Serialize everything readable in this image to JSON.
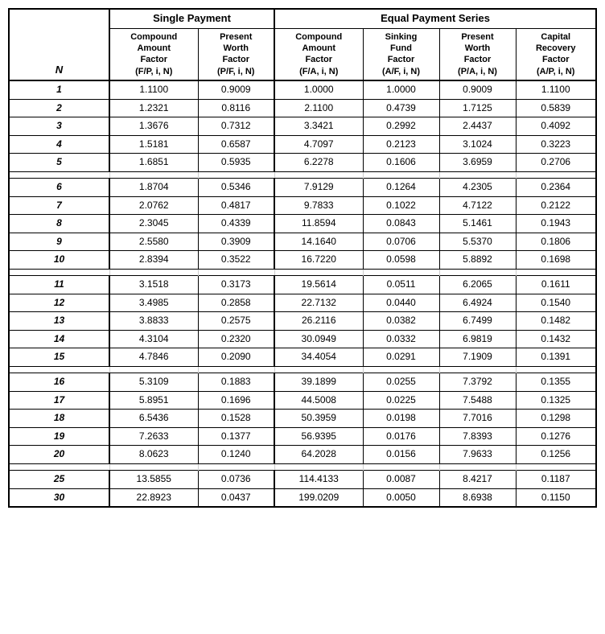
{
  "header": {
    "single_payment": "Single Payment",
    "equal_payment": "Equal Payment Series"
  },
  "col_headers": {
    "n": "N",
    "compound_amount_factor": "Compound\nAmount\nFactor\n(F/P, i, N)",
    "present_worth_factor": "Present\nWorth\nFactor\n(P/F, i, N)",
    "eq_compound_amount": "Compound\nAmount\nFactor\n(F/A, i, N)",
    "sinking_fund": "Sinking\nFund\nFactor\n(A/F, i, N)",
    "present_worth": "Present\nWorth\nFactor\n(P/A, i, N)",
    "capital_recovery": "Capital\nRecovery\nFactor\n(A/P, i, N)"
  },
  "rows": [
    {
      "n": "1",
      "f_p": "1.1100",
      "p_f": "0.9009",
      "f_a": "1.0000",
      "a_f": "1.0000",
      "p_a": "0.9009",
      "a_p": "1.1100"
    },
    {
      "n": "2",
      "f_p": "1.2321",
      "p_f": "0.8116",
      "f_a": "2.1100",
      "a_f": "0.4739",
      "p_a": "1.7125",
      "a_p": "0.5839"
    },
    {
      "n": "3",
      "f_p": "1.3676",
      "p_f": "0.7312",
      "f_a": "3.3421",
      "a_f": "0.2992",
      "p_a": "2.4437",
      "a_p": "0.4092"
    },
    {
      "n": "4",
      "f_p": "1.5181",
      "p_f": "0.6587",
      "f_a": "4.7097",
      "a_f": "0.2123",
      "p_a": "3.1024",
      "a_p": "0.3223"
    },
    {
      "n": "5",
      "f_p": "1.6851",
      "p_f": "0.5935",
      "f_a": "6.2278",
      "a_f": "0.1606",
      "p_a": "3.6959",
      "a_p": "0.2706"
    },
    {
      "n": "6",
      "f_p": "1.8704",
      "p_f": "0.5346",
      "f_a": "7.9129",
      "a_f": "0.1264",
      "p_a": "4.2305",
      "a_p": "0.2364"
    },
    {
      "n": "7",
      "f_p": "2.0762",
      "p_f": "0.4817",
      "f_a": "9.7833",
      "a_f": "0.1022",
      "p_a": "4.7122",
      "a_p": "0.2122"
    },
    {
      "n": "8",
      "f_p": "2.3045",
      "p_f": "0.4339",
      "f_a": "11.8594",
      "a_f": "0.0843",
      "p_a": "5.1461",
      "a_p": "0.1943"
    },
    {
      "n": "9",
      "f_p": "2.5580",
      "p_f": "0.3909",
      "f_a": "14.1640",
      "a_f": "0.0706",
      "p_a": "5.5370",
      "a_p": "0.1806"
    },
    {
      "n": "10",
      "f_p": "2.8394",
      "p_f": "0.3522",
      "f_a": "16.7220",
      "a_f": "0.0598",
      "p_a": "5.8892",
      "a_p": "0.1698"
    },
    {
      "n": "11",
      "f_p": "3.1518",
      "p_f": "0.3173",
      "f_a": "19.5614",
      "a_f": "0.0511",
      "p_a": "6.2065",
      "a_p": "0.1611"
    },
    {
      "n": "12",
      "f_p": "3.4985",
      "p_f": "0.2858",
      "f_a": "22.7132",
      "a_f": "0.0440",
      "p_a": "6.4924",
      "a_p": "0.1540"
    },
    {
      "n": "13",
      "f_p": "3.8833",
      "p_f": "0.2575",
      "f_a": "26.2116",
      "a_f": "0.0382",
      "p_a": "6.7499",
      "a_p": "0.1482"
    },
    {
      "n": "14",
      "f_p": "4.3104",
      "p_f": "0.2320",
      "f_a": "30.0949",
      "a_f": "0.0332",
      "p_a": "6.9819",
      "a_p": "0.1432"
    },
    {
      "n": "15",
      "f_p": "4.7846",
      "p_f": "0.2090",
      "f_a": "34.4054",
      "a_f": "0.0291",
      "p_a": "7.1909",
      "a_p": "0.1391"
    },
    {
      "n": "16",
      "f_p": "5.3109",
      "p_f": "0.1883",
      "f_a": "39.1899",
      "a_f": "0.0255",
      "p_a": "7.3792",
      "a_p": "0.1355"
    },
    {
      "n": "17",
      "f_p": "5.8951",
      "p_f": "0.1696",
      "f_a": "44.5008",
      "a_f": "0.0225",
      "p_a": "7.5488",
      "a_p": "0.1325"
    },
    {
      "n": "18",
      "f_p": "6.5436",
      "p_f": "0.1528",
      "f_a": "50.3959",
      "a_f": "0.0198",
      "p_a": "7.7016",
      "a_p": "0.1298"
    },
    {
      "n": "19",
      "f_p": "7.2633",
      "p_f": "0.1377",
      "f_a": "56.9395",
      "a_f": "0.0176",
      "p_a": "7.8393",
      "a_p": "0.1276"
    },
    {
      "n": "20",
      "f_p": "8.0623",
      "p_f": "0.1240",
      "f_a": "64.2028",
      "a_f": "0.0156",
      "p_a": "7.9633",
      "a_p": "0.1256"
    },
    {
      "n": "25",
      "f_p": "13.5855",
      "p_f": "0.0736",
      "f_a": "114.4133",
      "a_f": "0.0087",
      "p_a": "8.4217",
      "a_p": "0.1187"
    },
    {
      "n": "30",
      "f_p": "22.8923",
      "p_f": "0.0437",
      "f_a": "199.0209",
      "a_f": "0.0050",
      "p_a": "8.6938",
      "a_p": "0.1150"
    }
  ],
  "separator_groups": [
    5,
    10,
    15,
    20
  ]
}
